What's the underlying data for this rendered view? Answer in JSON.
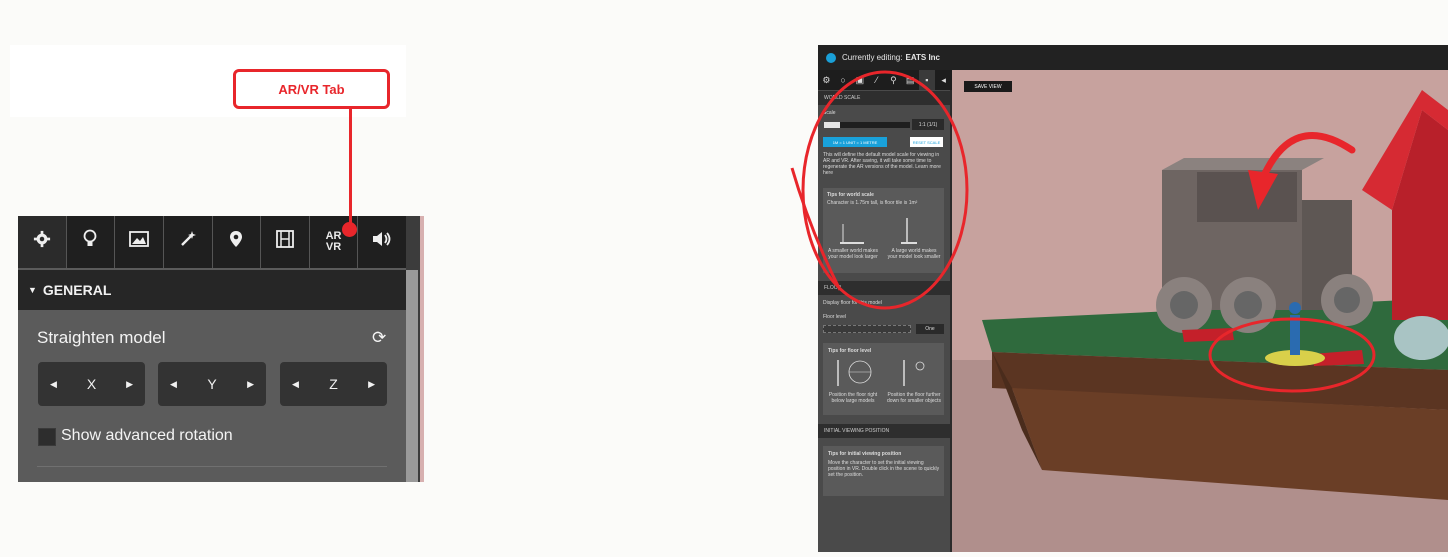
{
  "callout": {
    "label": "AR/VR Tab"
  },
  "panel": {
    "tabs": [
      {
        "icon": "gear-icon",
        "glyph": "⚙"
      },
      {
        "icon": "lightbulb-icon",
        "glyph": "💡"
      },
      {
        "icon": "image-icon",
        "glyph": "▣"
      },
      {
        "icon": "magic-wand-icon",
        "glyph": "⁄"
      },
      {
        "icon": "map-pin-icon",
        "glyph": "⚲"
      },
      {
        "icon": "film-icon",
        "glyph": "▤"
      },
      {
        "icon": "ar-vr-icon",
        "glyph_top": "AR",
        "glyph_bottom": "VR"
      },
      {
        "icon": "sound-icon",
        "glyph": "🔊"
      }
    ],
    "section": "GENERAL",
    "straighten_label": "Straighten model",
    "axes": [
      "X",
      "Y",
      "Z"
    ],
    "advanced_rotation_label": "Show advanced rotation",
    "advanced_rotation_checked": false
  },
  "app": {
    "currently_editing_label": "Currently editing:",
    "model_name": "EATS Inc",
    "world_scale_header": "WORLD SCALE",
    "scale_label": "Scale",
    "scale_value": "1:1 (1/1)",
    "unit_button": "1M = 1 UNIT = 1 METRE",
    "reset_scale_button": "RESET SCALE",
    "scale_description": "This will define the default model scale for viewing in AR and VR. After saving, it will take some time to regenerate the AR versions of the model. Learn more here",
    "tips_world_scale_title": "Tips for world scale",
    "tips_world_scale_subtitle": "Character is 1.75m tall, is floor tile is 1m²",
    "tip_small": "A smaller world makes your model look larger",
    "tip_large": "A large world makes your model look smaller",
    "floor_header": "FLOOR",
    "display_floor_label": "Display floor for this model",
    "floor_level_label": "Floor level",
    "floor_button": "One",
    "tips_floor_title": "Tips for floor level",
    "tip_floor_left": "Position the floor right below large models",
    "tip_floor_right": "Position the floor further down for smaller objects",
    "viewing_header": "INITIAL VIEWING POSITION",
    "tips_viewing_title": "Tips for initial viewing position",
    "tips_viewing_body": "Move the character to set the initial viewing position in VR. Double click in the scene to quickly set the position.",
    "save_view_button": "SAVE VIEW"
  },
  "colors": {
    "accent_red": "#e8262b",
    "brand_blue": "#19a1da",
    "panel_dark": "#1f1f1f",
    "panel_mid": "#5b5b5b",
    "scene_wall": "#c9a4a0",
    "scene_floor": "#2f6a3d"
  }
}
